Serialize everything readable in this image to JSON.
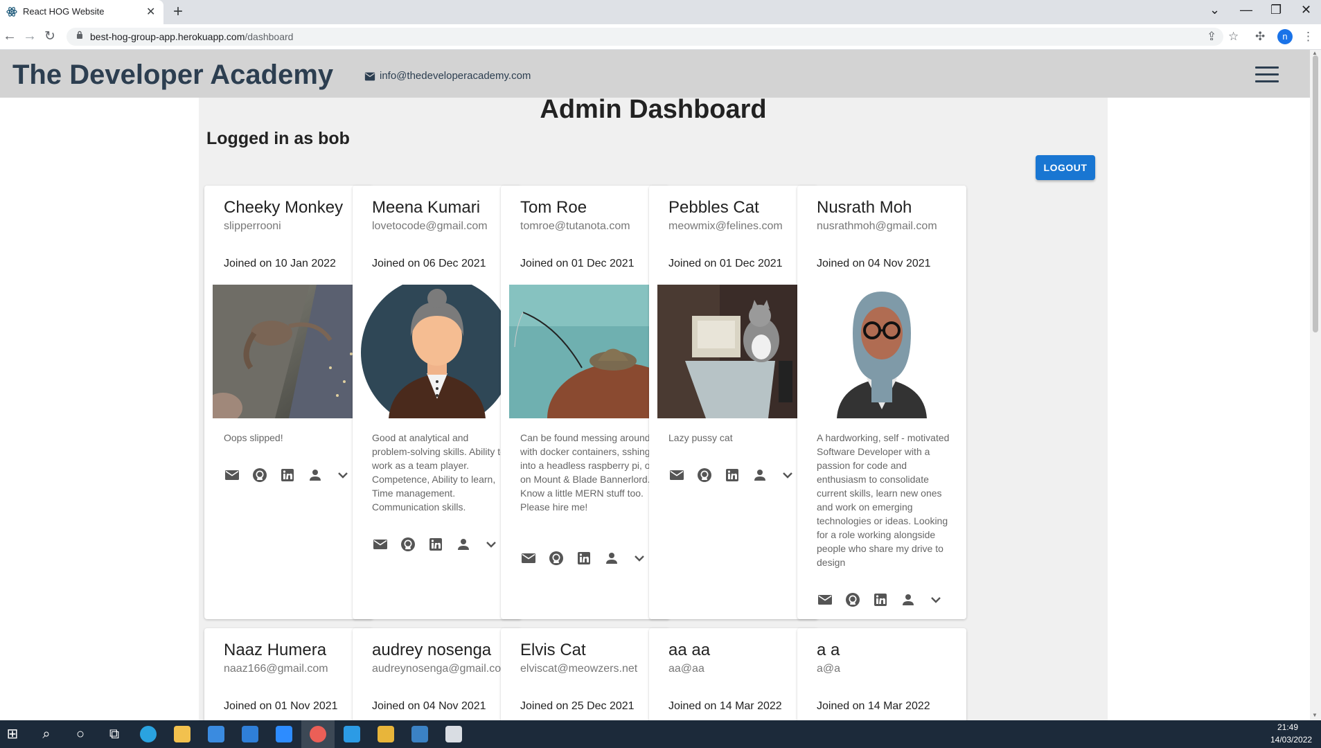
{
  "browser": {
    "tab_title": "React HOG Website",
    "url_domain": "best-hog-group-app.herokuapp.com",
    "url_path": "/dashboard",
    "profile_initial": "n"
  },
  "header": {
    "brand": "The Developer Academy",
    "email": "info@thedeveloperacademy.com"
  },
  "dashboard": {
    "title": "Admin Dashboard",
    "logged_in": "Logged in as bob",
    "logout_label": "LOGOUT"
  },
  "cards": [
    {
      "name": "Cheeky Monkey",
      "email": "slipperrooni",
      "joined": "Joined on 10 Jan 2022",
      "bio": "Oops slipped!",
      "image": "monkey-photo"
    },
    {
      "name": "Meena Kumari",
      "email": "lovetocode@gmail.com",
      "joined": "Joined on 06 Dec 2021",
      "bio": "Good at analytical and problem-solving skills. Ability to work as a team player. Competence, Ability to learn, Time management. Communication skills.",
      "image": "woman-avatar"
    },
    {
      "name": "Tom Roe",
      "email": "tomroe@tutanota.com",
      "joined": "Joined on 01 Dec 2021",
      "bio": "Can be found messing around with docker containers, sshing into a headless raspberry pi, or on Mount & Blade Bannerlord. Know a little MERN stuff too. Please hire me!",
      "image": "fishing-photo"
    },
    {
      "name": "Pebbles Cat",
      "email": "meowmix@felines.com",
      "joined": "Joined on 01 Dec 2021",
      "bio": "Lazy pussy cat",
      "image": "cat-computer-photo"
    },
    {
      "name": "Nusrath Moh",
      "email": "nusrathmoh@gmail.com",
      "joined": "Joined on 04 Nov 2021",
      "bio": "A hardworking, self - motivated Software Developer with a passion for code and enthusiasm to consolidate current skills, learn new ones and work on emerging technologies or ideas. Looking for a role working alongside people who share my drive to design",
      "image": "hijab-avatar"
    },
    {
      "name": "Naaz Humera",
      "email": "naaz166@gmail.com",
      "joined": "Joined on 01 Nov 2021"
    },
    {
      "name": "audrey nosenga",
      "email": "audreynosenga@gmail.co",
      "joined": "Joined on 04 Nov 2021"
    },
    {
      "name": "Elvis Cat",
      "email": "elviscat@meowzers.net",
      "joined": "Joined on 25 Dec 2021"
    },
    {
      "name": "aa aa",
      "email": "aa@aa",
      "joined": "Joined on 14 Mar 2022"
    },
    {
      "name": "a a",
      "email": "a@a",
      "joined": "Joined on 14 Mar 2022"
    }
  ],
  "card_actions": [
    "email-icon",
    "github-icon",
    "linkedin-icon",
    "person-icon",
    "expand-more-icon"
  ],
  "taskbar": {
    "time": "21:49",
    "date": "14/03/2022",
    "apps": [
      "start-icon",
      "search-icon",
      "cortana-icon",
      "task-view-icon",
      "edge-icon",
      "file-explorer-icon",
      "store-icon",
      "mail-icon",
      "zoom-icon",
      "chrome-icon",
      "vscode-icon",
      "slack-icon",
      "photos-icon",
      "notepad-icon"
    ]
  },
  "colors": {
    "header_bg": "#d3d3d3",
    "brand_text": "#2c3e50",
    "logout_bg": "#1976d2",
    "container_bg": "#f0f0f0",
    "taskbar_bg": "#1c2a3a"
  }
}
